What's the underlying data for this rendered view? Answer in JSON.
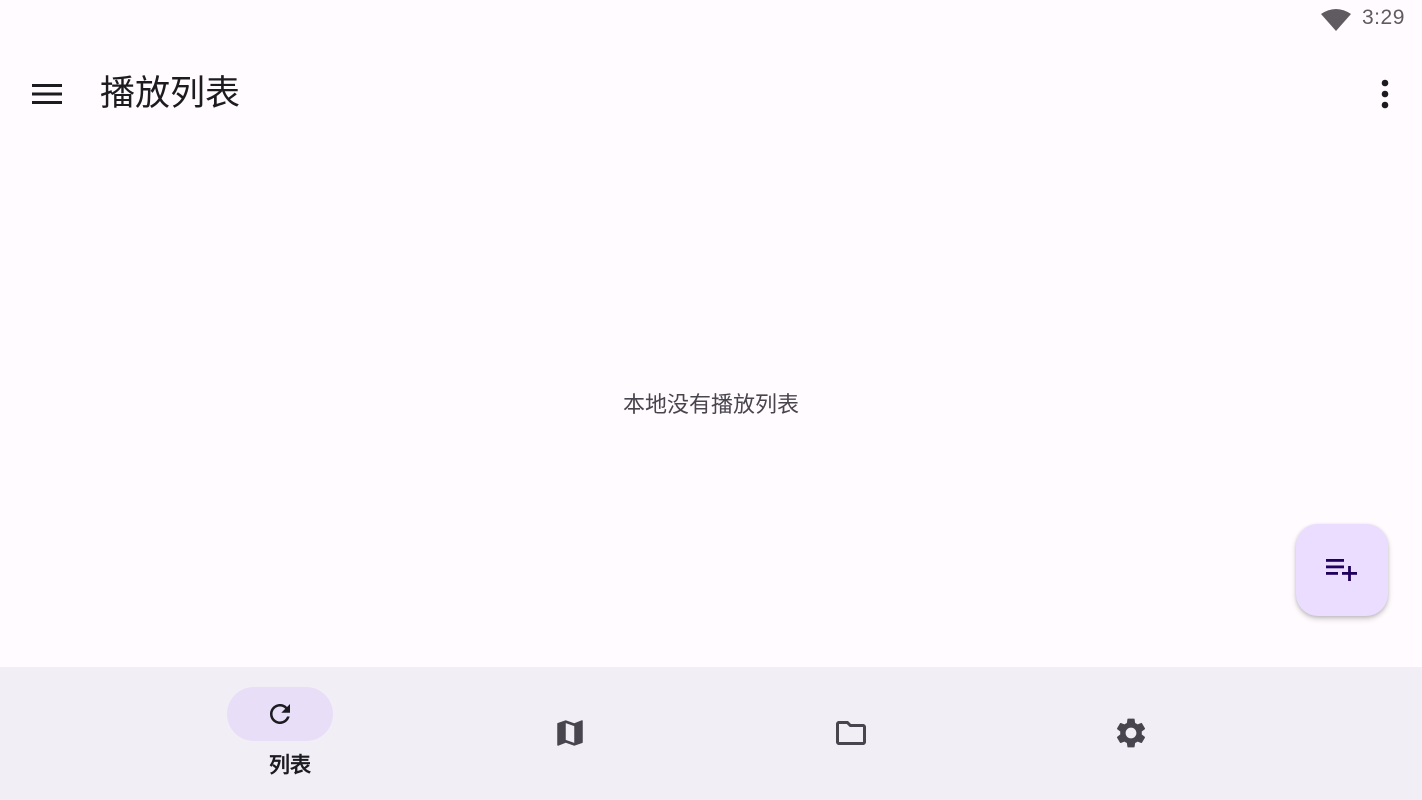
{
  "status_bar": {
    "wifi_icon": "wifi-icon",
    "time": "3:29"
  },
  "app_bar": {
    "menu_icon": "menu-icon",
    "title": "播放列表",
    "overflow_icon": "more-vert-icon"
  },
  "main": {
    "empty_message": "本地没有播放列表"
  },
  "fab": {
    "icon": "playlist-add-icon",
    "color": "#eaddff"
  },
  "bottom_nav": {
    "items": [
      {
        "icon": "refresh-icon",
        "label": "列表",
        "active": true
      },
      {
        "icon": "map-icon",
        "label": "",
        "active": false
      },
      {
        "icon": "folder-icon",
        "label": "",
        "active": false
      },
      {
        "icon": "settings-gear-icon",
        "label": "",
        "active": false
      }
    ],
    "background": "#f2eef6",
    "active_indicator": "#e8def8"
  },
  "colors": {
    "background": "#fffbfe",
    "on_surface": "#1c1b1f",
    "on_surface_variant": "#49454f",
    "icon": "#49454f"
  }
}
